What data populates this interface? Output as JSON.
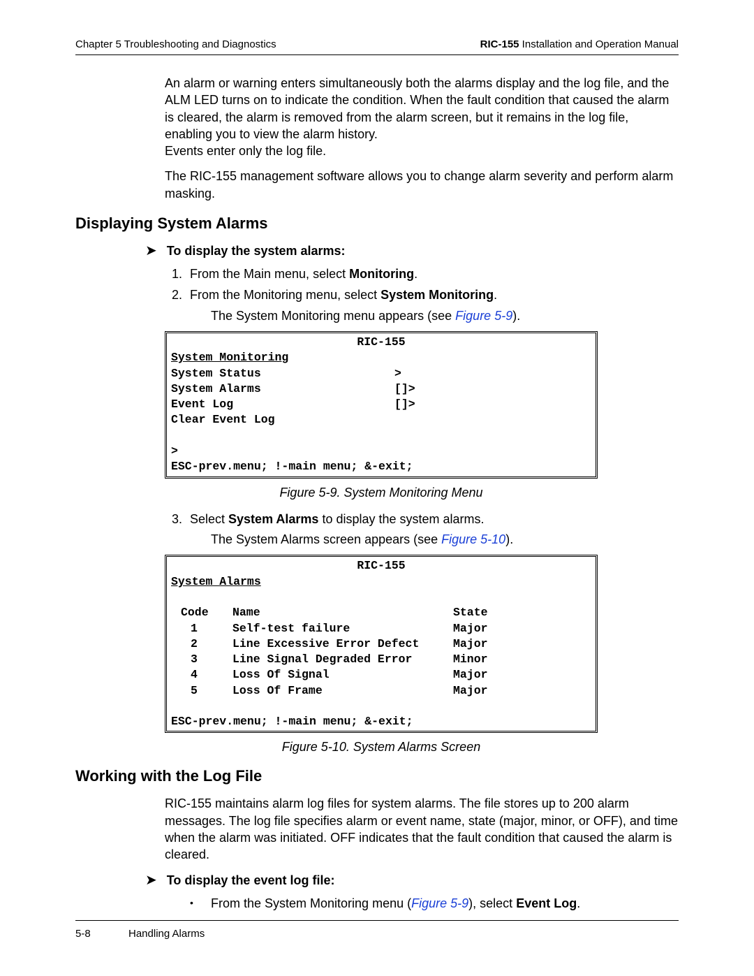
{
  "header": {
    "left_chapter": "Chapter 5  Troubleshooting and Diagnostics",
    "right_product_bold": "RIC-155",
    "right_product_rest": " Installation and Operation Manual"
  },
  "intro": {
    "para1": "An alarm or warning enters simultaneously both the alarms display and the log file, and the ALM LED turns on to indicate the condition. When the fault condition that caused the alarm is cleared, the alarm is removed from the alarm screen, but it remains in the log file, enabling you to view the alarm history.",
    "para1b": "Events enter only the log file.",
    "para2": "The RIC-155 management software allows you to change alarm severity and perform alarm masking."
  },
  "section1": {
    "heading": "Displaying System Alarms",
    "arrow_label": "To display the system alarms:",
    "step1_pre": "From the Main menu, select ",
    "step1_bold": "Monitoring",
    "step1_post": ".",
    "step2_pre": "From the Monitoring menu, select ",
    "step2_bold": "System Monitoring",
    "step2_post": ".",
    "step2_result_pre": "The System Monitoring menu appears (see ",
    "step2_result_link": "Figure 5-9",
    "step2_result_post": ").",
    "fig1_caption": "Figure 5-9.  System Monitoring Menu",
    "step3_pre": "Select ",
    "step3_bold": "System Alarms",
    "step3_post": " to display the system alarms.",
    "step3_result_pre": "The System Alarms screen appears (see ",
    "step3_result_link": "Figure 5-10",
    "step3_result_post": ").",
    "fig2_caption": "Figure 5-10.  System Alarms Screen"
  },
  "codebox1": {
    "title": "RIC-155",
    "sub": "System Monitoring",
    "rows": [
      {
        "label": "System Status",
        "sym": ">"
      },
      {
        "label": "System Alarms",
        "sym": "[]>"
      },
      {
        "label": "Event Log",
        "sym": "[]>"
      },
      {
        "label": "Clear Event Log",
        "sym": ""
      }
    ],
    "prompt": ">",
    "footer": "ESC-prev.menu; !-main menu; &-exit;"
  },
  "codebox2": {
    "title": "RIC-155",
    "sub": "System Alarms",
    "hdr": {
      "code": "Code",
      "name": "Name",
      "state": "State"
    },
    "rows": [
      {
        "code": "1",
        "name": "Self-test failure",
        "state": "Major"
      },
      {
        "code": "2",
        "name": "Line Excessive Error Defect",
        "state": "Major"
      },
      {
        "code": "3",
        "name": "Line Signal Degraded Error",
        "state": "Minor"
      },
      {
        "code": "4",
        "name": "Loss Of Signal",
        "state": "Major"
      },
      {
        "code": "5",
        "name": "Loss Of Frame",
        "state": "Major"
      }
    ],
    "footer": "ESC-prev.menu; !-main menu; &-exit;"
  },
  "section2": {
    "heading": "Working with the Log File",
    "para": "RIC-155 maintains alarm log files for system alarms. The file stores up to 200 alarm messages. The log file specifies alarm or event name, state (major, minor, or OFF), and time when the alarm was initiated. OFF indicates that the fault condition that caused the alarm is cleared.",
    "arrow_label": "To display the event log file:",
    "bullet_pre": "From the System Monitoring menu (",
    "bullet_link": "Figure 5-9",
    "bullet_mid": "), select ",
    "bullet_bold": "Event Log",
    "bullet_post": "."
  },
  "footer": {
    "page": "5-8",
    "section": "Handling Alarms"
  }
}
